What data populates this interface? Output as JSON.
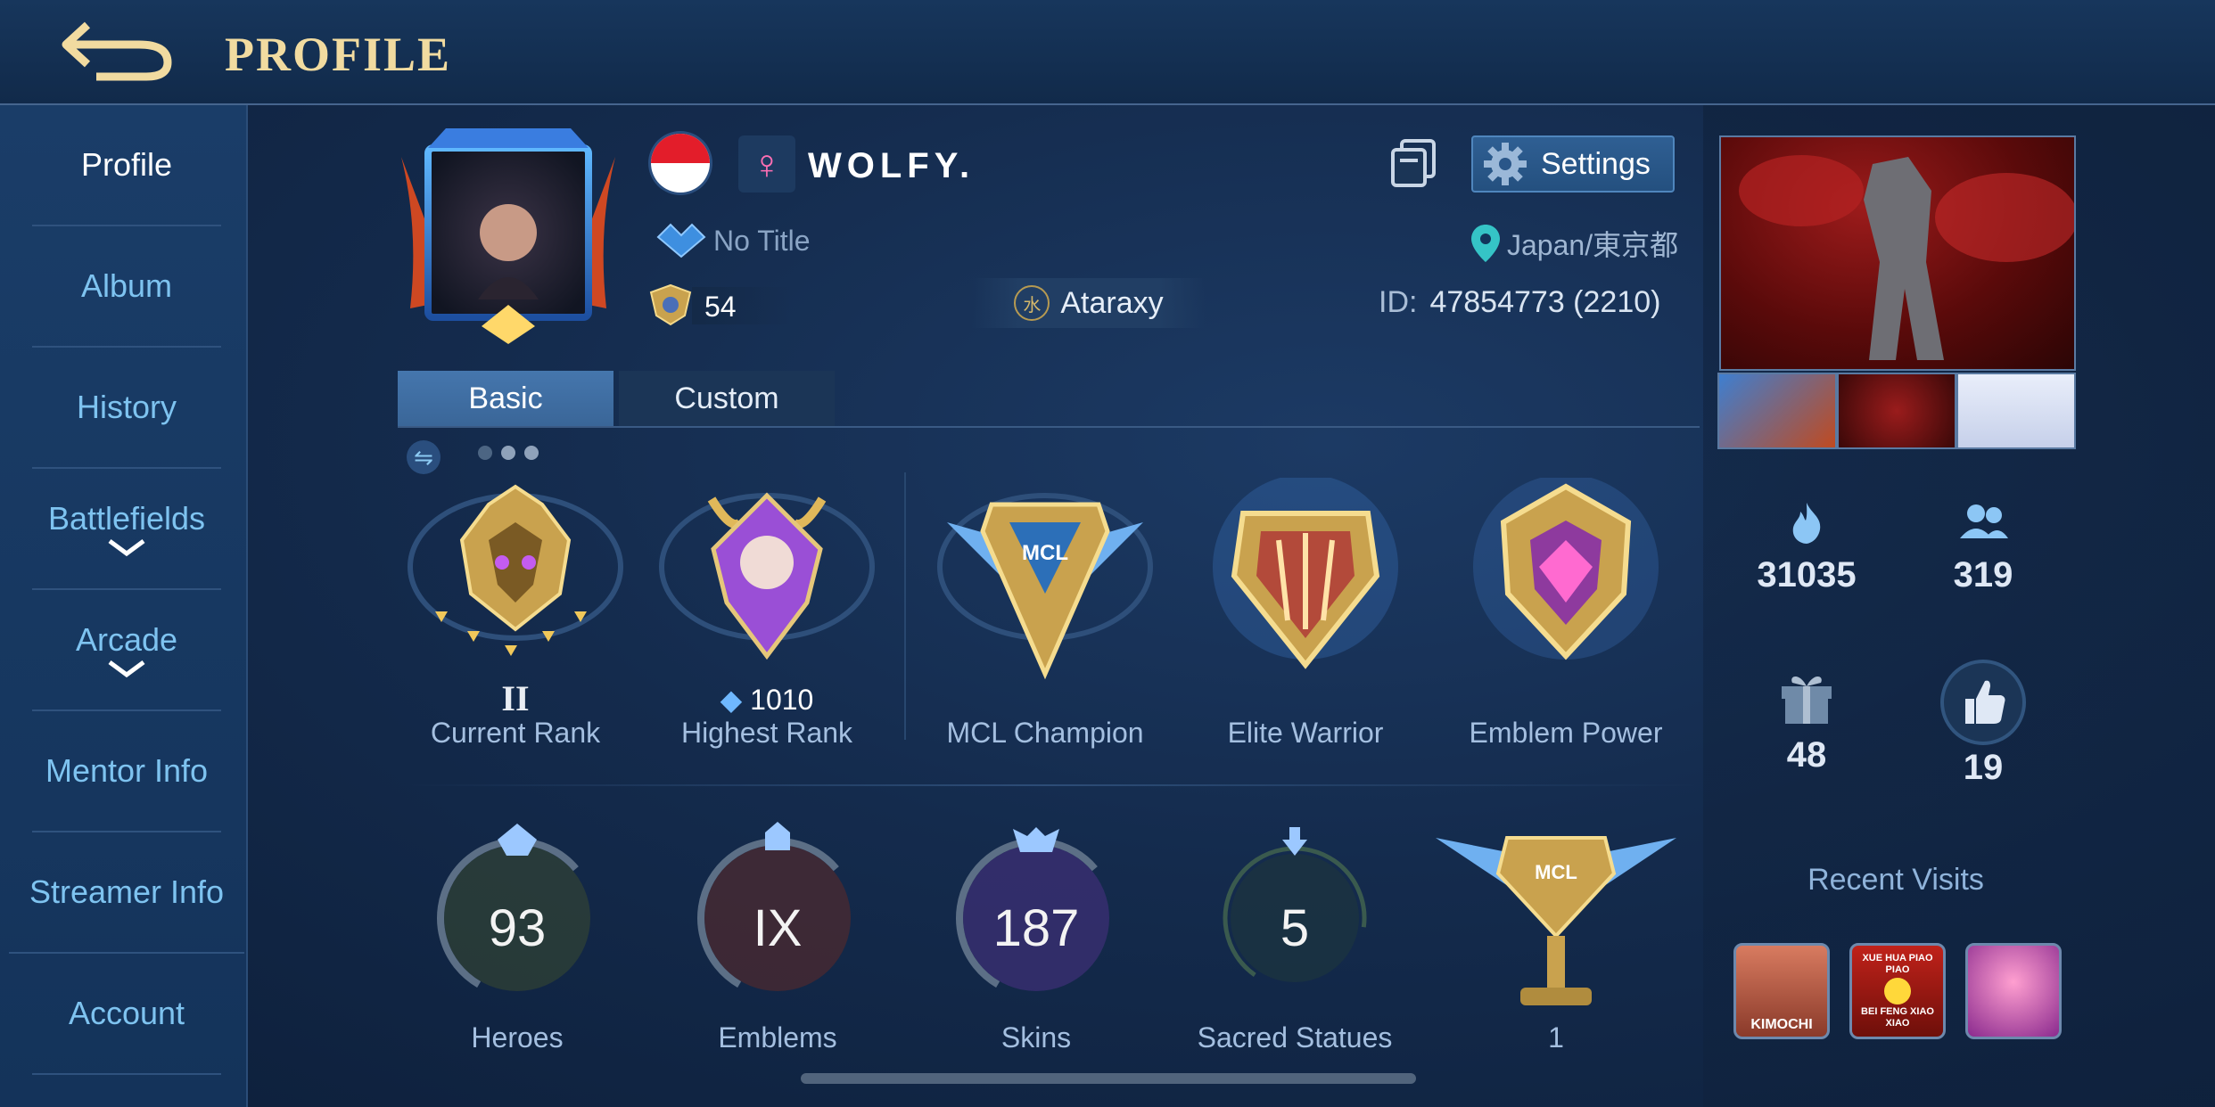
{
  "header": {
    "title": "PROFILE",
    "back_icon": "back-arrow-icon"
  },
  "sidebar": {
    "items": [
      {
        "label": "Profile",
        "active": true
      },
      {
        "label": "Album"
      },
      {
        "label": "History"
      },
      {
        "label": "Battlefields",
        "expandable": true
      },
      {
        "label": "Arcade",
        "expandable": true
      },
      {
        "label": "Mentor Info"
      },
      {
        "label": "Streamer Info"
      },
      {
        "label": "Account"
      }
    ]
  },
  "player": {
    "name": "WOLFY.",
    "gender_symbol": "♀",
    "title": "No Title",
    "level": "54",
    "squad_icon_char": "水",
    "squad": "Ataraxy",
    "id_label": "ID:",
    "id_value": "47854773 (2210)",
    "location": "Japan/東京都",
    "flag": "Singapore"
  },
  "actions": {
    "settings_label": "Settings"
  },
  "tabs": [
    {
      "label": "Basic",
      "active": true
    },
    {
      "label": "Custom"
    }
  ],
  "badges": {
    "current_rank": {
      "tier": "II",
      "label": "Current Rank"
    },
    "highest_rank": {
      "points": "1010",
      "label": "Highest Rank"
    },
    "mcl_champion": {
      "label": "MCL Champion"
    },
    "elite_warrior": {
      "label": "Elite Warrior"
    },
    "emblem_power": {
      "label": "Emblem Power"
    }
  },
  "stats": [
    {
      "value": "93",
      "label": "Heroes"
    },
    {
      "value": "IX",
      "label": "Emblems"
    },
    {
      "value": "187",
      "label": "Skins"
    },
    {
      "value": "5",
      "label": "Sacred Statues"
    },
    {
      "value": "1",
      "label": ""
    }
  ],
  "right_panel": {
    "popularity": "31035",
    "followers": "319",
    "gifts": "48",
    "likes": "19",
    "recent_visits_title": "Recent Visits",
    "visits": [
      {
        "caption": "KIMOCHI"
      },
      {
        "caption_top": "XUE HUA PIAO PIAO",
        "caption_bottom": "BEI FENG XIAO XIAO"
      },
      {
        "caption": ""
      }
    ]
  },
  "colors": {
    "accent_gold": "#f1dba0",
    "sidebar_text": "#7ec3f0",
    "tab_active": "#4576ad"
  }
}
